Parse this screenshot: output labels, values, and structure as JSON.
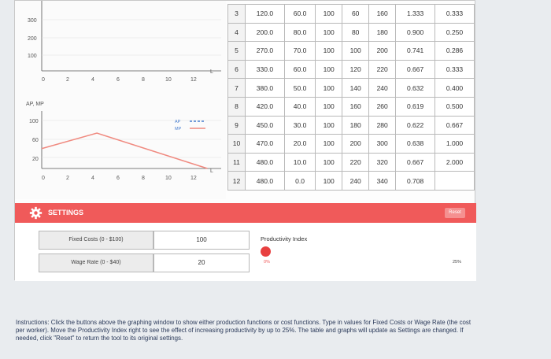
{
  "top_chart": {
    "y_ticks": [
      "300",
      "200",
      "100"
    ],
    "x_ticks": [
      "0",
      "2",
      "4",
      "6",
      "8",
      "10",
      "12"
    ],
    "x_axis_end": "L"
  },
  "bottom_chart": {
    "y_title": "AP, MP",
    "y_ticks": [
      "100",
      "60",
      "20"
    ],
    "x_ticks": [
      "0",
      "2",
      "4",
      "6",
      "8",
      "10",
      "12"
    ],
    "x_axis_end": "L",
    "legend_ap": "AP",
    "legend_mp": "MP",
    "colors": {
      "ap": "#4a7fd0",
      "mp": "#f08a80"
    }
  },
  "chart_data": [
    {
      "type": "line",
      "ylim": [
        0,
        400
      ],
      "xlim": [
        0,
        13
      ]
    },
    {
      "type": "line",
      "ylim": [
        0,
        130
      ],
      "xlim": [
        0,
        13
      ],
      "series": [
        {
          "name": "MP",
          "x": [
            0,
            4,
            12
          ],
          "y": [
            45,
            80,
            0
          ]
        }
      ]
    }
  ],
  "table": {
    "rows": [
      [
        "3",
        "120.0",
        "60.0",
        "100",
        "60",
        "160",
        "1.333",
        "0.333"
      ],
      [
        "4",
        "200.0",
        "80.0",
        "100",
        "80",
        "180",
        "0.900",
        "0.250"
      ],
      [
        "5",
        "270.0",
        "70.0",
        "100",
        "100",
        "200",
        "0.741",
        "0.286"
      ],
      [
        "6",
        "330.0",
        "60.0",
        "100",
        "120",
        "220",
        "0.667",
        "0.333"
      ],
      [
        "7",
        "380.0",
        "50.0",
        "100",
        "140",
        "240",
        "0.632",
        "0.400"
      ],
      [
        "8",
        "420.0",
        "40.0",
        "100",
        "160",
        "260",
        "0.619",
        "0.500"
      ],
      [
        "9",
        "450.0",
        "30.0",
        "100",
        "180",
        "280",
        "0.622",
        "0.667"
      ],
      [
        "10",
        "470.0",
        "20.0",
        "100",
        "200",
        "300",
        "0.638",
        "1.000"
      ],
      [
        "11",
        "480.0",
        "10.0",
        "100",
        "220",
        "320",
        "0.667",
        "2.000"
      ],
      [
        "12",
        "480.0",
        "0.0",
        "100",
        "240",
        "340",
        "0.708",
        ""
      ]
    ]
  },
  "settings": {
    "title": "SETTINGS",
    "reset_label": "Reset",
    "fixed_costs_label": "Fixed Costs (0 - $100)",
    "fixed_costs_value": "100",
    "wage_rate_label": "Wage Rate (0 - $40)",
    "wage_rate_value": "20",
    "productivity_label": "Productivity Index",
    "productivity_min": "0%",
    "productivity_max": "25%",
    "productivity_value": 0,
    "colors": {
      "bar": "#f05a5a",
      "knob": "#e84040"
    }
  },
  "instructions": "Instructions: Click the buttons above the graphing window to show either production functions or cost functions. Type in values for Fixed Costs or Wage Rate (the cost per worker). Move the Productivity Index right to see the effect of increasing productivity by up to 25%. The table and graphs will update as Settings are changed. If needed, click \"Reset\" to return the tool to its original settings."
}
